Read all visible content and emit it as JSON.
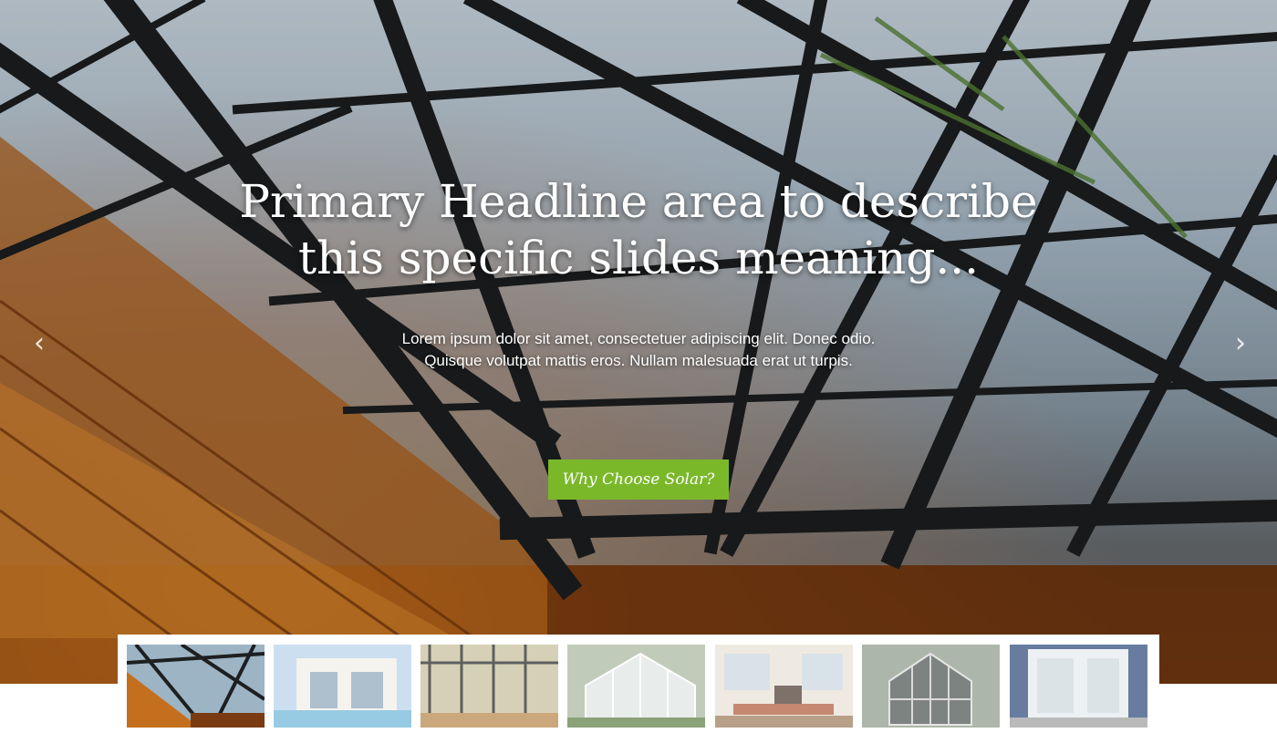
{
  "hero": {
    "headline": "Primary Headline area to describe this specific slides meaning...",
    "subtext_line1": "Lorem ipsum dolor sit amet, consectetuer adipiscing elit. Donec odio.",
    "subtext_line2": "Quisque volutpat mattis eros. Nullam malesuada erat ut turpis.",
    "cta_label": "Why Choose Solar?",
    "prev_arrow": "‹",
    "next_arrow": "›",
    "prev_icon": "chevron-left-icon",
    "next_icon": "chevron-right-icon"
  },
  "colors": {
    "cta": "#7ab82a",
    "text": "#ffffff"
  },
  "thumbnails": {
    "active_index": 0,
    "items": [
      {
        "name": "skylight-roof"
      },
      {
        "name": "pool-house"
      },
      {
        "name": "glass-corridor"
      },
      {
        "name": "conservatory-exterior"
      },
      {
        "name": "living-room"
      },
      {
        "name": "garden-greenhouse"
      },
      {
        "name": "glass-doors"
      }
    ]
  }
}
